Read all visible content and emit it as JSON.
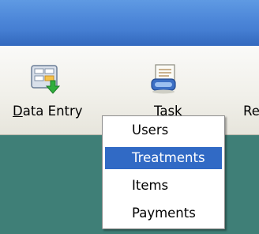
{
  "toolbar": {
    "buttons": [
      {
        "label_prefix": "D",
        "label_rest": "ata Entry",
        "icon": "data-entry-icon"
      },
      {
        "label": "Task",
        "icon": "task-icon"
      },
      {
        "label": "Re",
        "icon": "reports-icon"
      }
    ]
  },
  "dropdown_menu": {
    "items": [
      {
        "label": "Users",
        "selected": false
      },
      {
        "label": "Treatments",
        "selected": true
      },
      {
        "label": "Items",
        "selected": false
      },
      {
        "label": "Payments",
        "selected": false
      }
    ]
  },
  "colors": {
    "title_bar": "#4c86d8",
    "toolbar_bg": "#f1f0ea",
    "workspace_bg": "#3f7f77",
    "menu_highlight": "#316ac5"
  }
}
